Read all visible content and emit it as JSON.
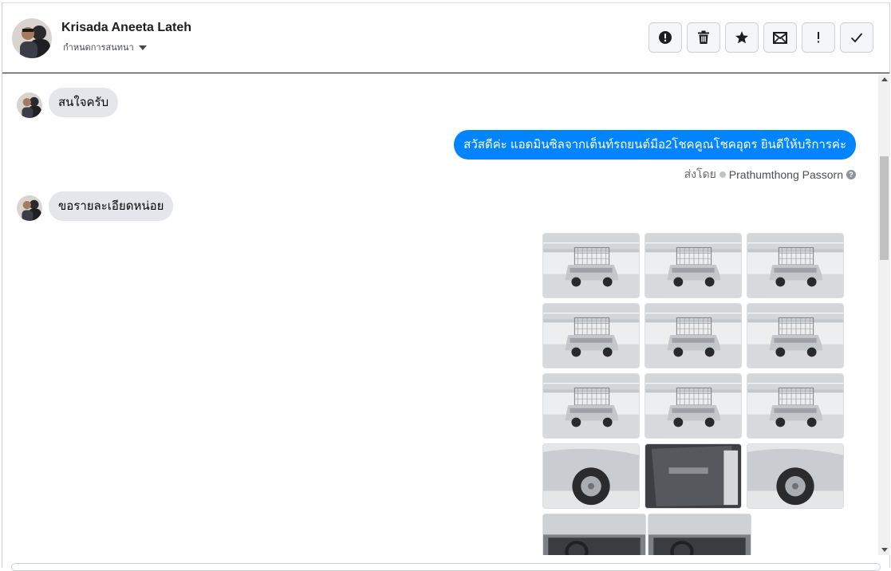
{
  "header": {
    "contact_name": "Krisada Aneeta Lateh",
    "assign_label": "กำหนดการสนทนา",
    "actions": [
      {
        "name": "spam-button",
        "icon": "exclamation-circle-icon"
      },
      {
        "name": "delete-button",
        "icon": "trash-icon"
      },
      {
        "name": "star-button",
        "icon": "star-icon"
      },
      {
        "name": "mark-unread-button",
        "icon": "envelope-icon"
      },
      {
        "name": "follow-up-button",
        "icon": "exclamation-icon"
      },
      {
        "name": "done-button",
        "icon": "checkmark-icon"
      }
    ]
  },
  "messages": [
    {
      "direction": "incoming",
      "text": "สนใจครับ"
    },
    {
      "direction": "outgoing",
      "text": "สวัสดีค่ะ แอดมินซิลจากเต็นท์รถยนต์มือ2โชคคูณโชคอุดร ยินดีให้บริการค่ะ"
    },
    {
      "direction": "incoming",
      "text": "ขอรายละเอียดหน่อย"
    }
  ],
  "sent_by": {
    "prefix": "ส่งโดย",
    "agent": "Prathumthong Passorn"
  },
  "photo_grid": {
    "count": 14,
    "subjects": [
      "truck-front",
      "truck-front-side",
      "truck-side-right",
      "truck-rear-left",
      "truck-side-left",
      "truck-rear",
      "truck-side-left-2",
      "truck-rear-quarter",
      "truck-rear-quarter-2",
      "front-wheel",
      "door-interior",
      "rear-wheel",
      "dashboard",
      "seats"
    ]
  },
  "colors": {
    "accent": "#0084ff",
    "incoming_bubble": "#e4e6eb",
    "muted_text": "#65676b"
  }
}
